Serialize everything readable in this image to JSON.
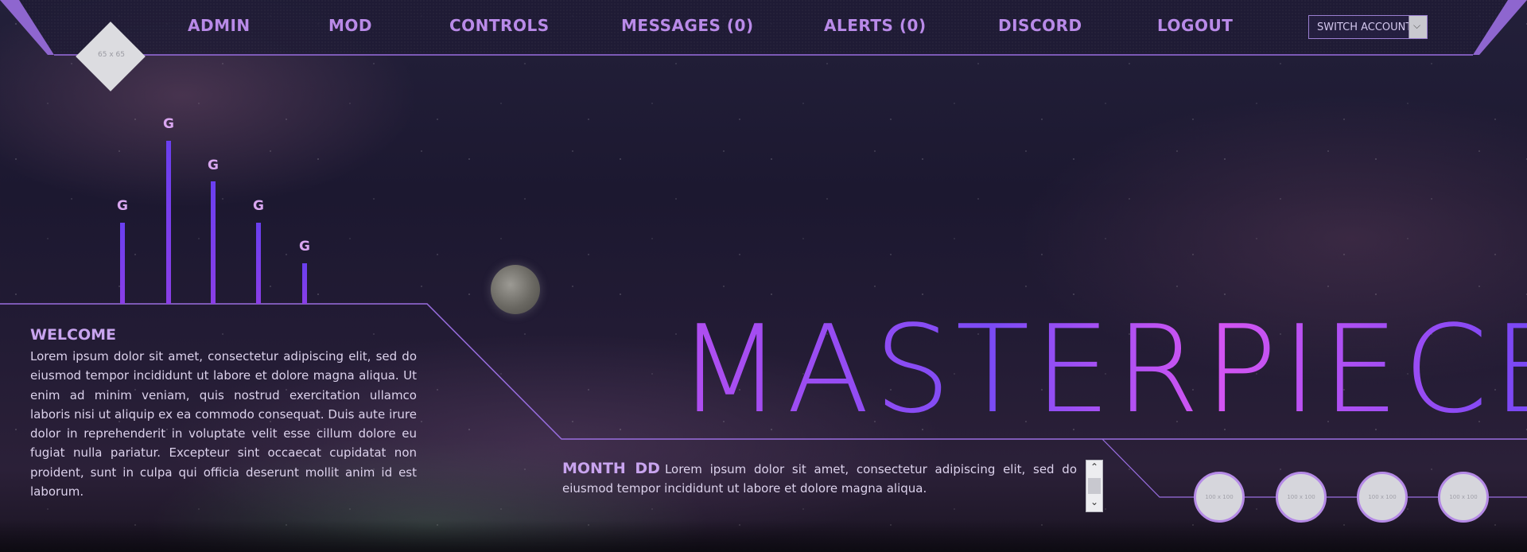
{
  "nav": {
    "items": [
      "ADMIN",
      "MOD",
      "CONTROLS",
      "MESSAGES (0)",
      "ALERTS (0)",
      "DISCORD",
      "LOGOUT"
    ],
    "switch_label": "SWITCH ACCOUNT"
  },
  "logo": {
    "placeholder": "65 x 65"
  },
  "bars": {
    "labels": [
      "G",
      "G",
      "G",
      "G",
      "G"
    ]
  },
  "welcome": {
    "title": "WELCOME",
    "body": "Lorem ipsum dolor sit amet, consectetur adipiscing elit, sed do eiusmod tempor incididunt ut labore et dolore magna aliqua. Ut enim ad minim veniam, quis nostrud exercitation ullamco laboris nisi ut aliquip ex ea commodo consequat. Duis aute irure dolor in reprehenderit in voluptate velit esse cillum dolore eu fugiat nulla pariatur. Excepteur sint occaecat cupidatat non proident, sunt in culpa qui officia deserunt mollit anim id est laborum."
  },
  "hero": {
    "title": "MASTERPIECE"
  },
  "news": {
    "date": "MONTH DD",
    "body": "Lorem ipsum dolor sit amet, consectetur adipiscing elit, sed do eiusmod tempor incididunt ut labore et dolore magna aliqua."
  },
  "avatars": [
    "100 x 100",
    "100 x 100",
    "100 x 100",
    "100 x 100"
  ],
  "colors": {
    "accent": "#b98ae8",
    "line": "#9a6ee0",
    "bar": "#6a3ff0"
  }
}
